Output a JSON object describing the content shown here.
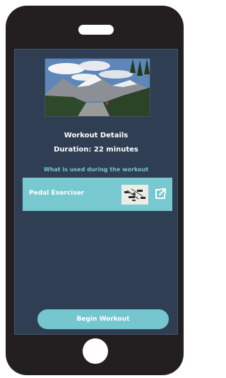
{
  "workout": {
    "title": "Workout Details",
    "duration": "Duration: 22 minutes",
    "hero_image": "mountain-road-photo"
  },
  "equipment": {
    "heading": "What is used during the workout",
    "items": [
      {
        "label": "Pedal Exerciser",
        "thumbnail": "pedal-exerciser-photo",
        "action_icon": "external-link-icon"
      }
    ]
  },
  "actions": {
    "begin_label": "Begin Workout"
  },
  "colors": {
    "phone_body": "#231f20",
    "screen_background": "#2f3e52",
    "accent": "#78c9cf",
    "accent_text": "#76c6cd",
    "text": "#ffffff"
  }
}
